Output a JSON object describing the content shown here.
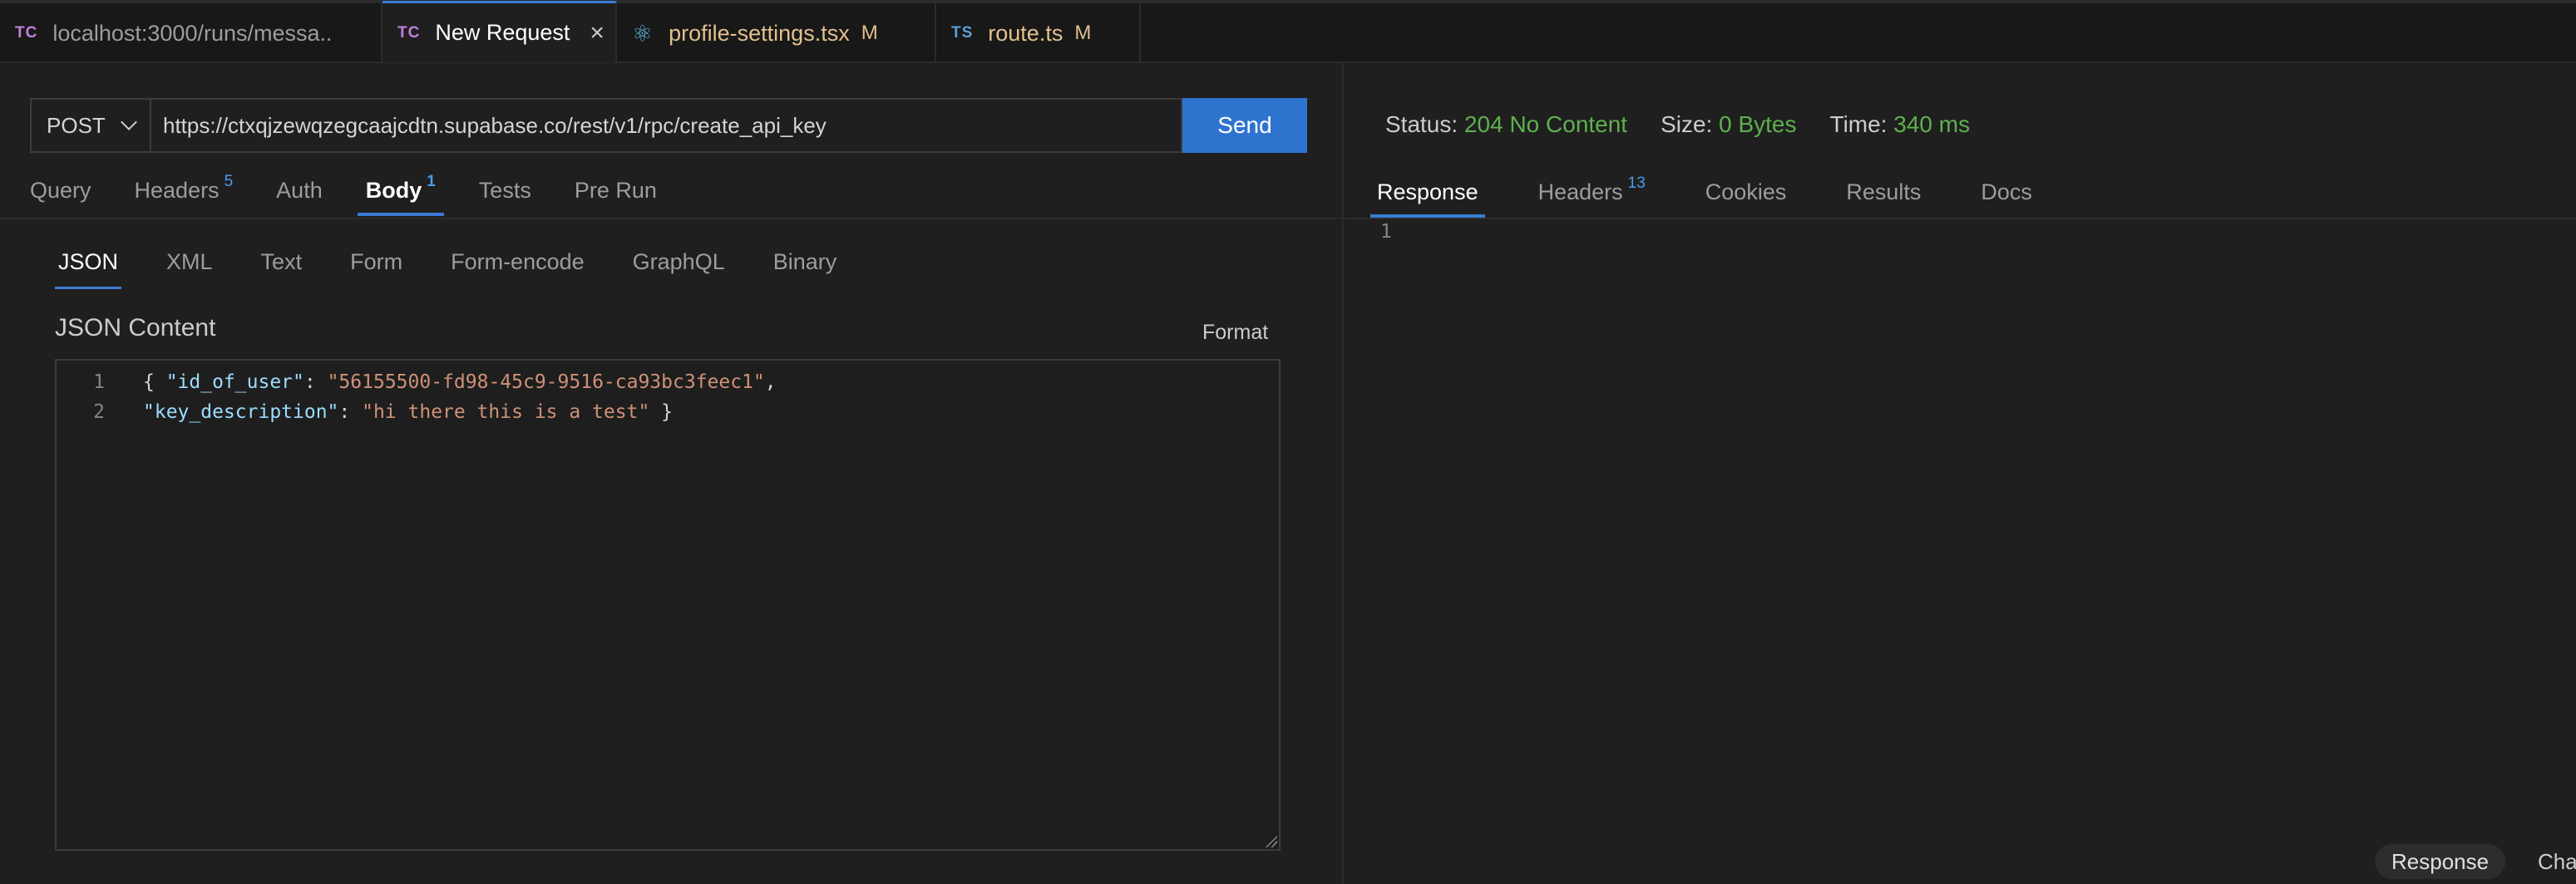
{
  "tabs": [
    {
      "icon": "TC",
      "label": "localhost:3000/runs/messa..",
      "active": false
    },
    {
      "icon": "TC",
      "label": "New Request",
      "active": true
    },
    {
      "icon": "⚛",
      "label": "profile-settings.tsx",
      "flag": "M"
    },
    {
      "icon": "TS",
      "label": "route.ts",
      "flag": "M"
    }
  ],
  "request": {
    "method": "POST",
    "url": "https://ctxqjzewqzegcaajcdtn.supabase.co/rest/v1/rpc/create_api_key",
    "send_label": "Send",
    "tabs": [
      {
        "label": "Query"
      },
      {
        "label": "Headers",
        "count": "5"
      },
      {
        "label": "Auth"
      },
      {
        "label": "Body",
        "count": "1"
      },
      {
        "label": "Tests"
      },
      {
        "label": "Pre Run"
      }
    ],
    "body_tabs": [
      "JSON",
      "XML",
      "Text",
      "Form",
      "Form-encode",
      "GraphQL",
      "Binary"
    ],
    "json_label": "JSON Content",
    "format_label": "Format",
    "editor": {
      "line_numbers": [
        "1",
        "2"
      ],
      "line1": {
        "open": "{ ",
        "key": "\"id_of_user\"",
        "colon": ": ",
        "value": "\"56155500-fd98-45c9-9516-ca93bc3feec1\"",
        "comma": ","
      },
      "line2": {
        "key": "\"key_description\"",
        "colon": ": ",
        "value": "\"hi there this is a test\"",
        "close": " }"
      }
    }
  },
  "response": {
    "status_label": "Status:",
    "status_value": "204 No Content",
    "size_label": "Size:",
    "size_value": "0 Bytes",
    "time_label": "Time:",
    "time_value": "340 ms",
    "tabs": [
      {
        "label": "Response"
      },
      {
        "label": "Headers",
        "count": "13"
      },
      {
        "label": "Cookies"
      },
      {
        "label": "Results"
      },
      {
        "label": "Docs"
      }
    ],
    "line_number": "1",
    "bottom_chip": "Response",
    "bottom_cut": "Cha"
  },
  "colors": {
    "accent": "#3a7bd5",
    "send_button": "#2e74cf",
    "status_ok": "#5fb04f",
    "modified": "#e2c08d"
  }
}
